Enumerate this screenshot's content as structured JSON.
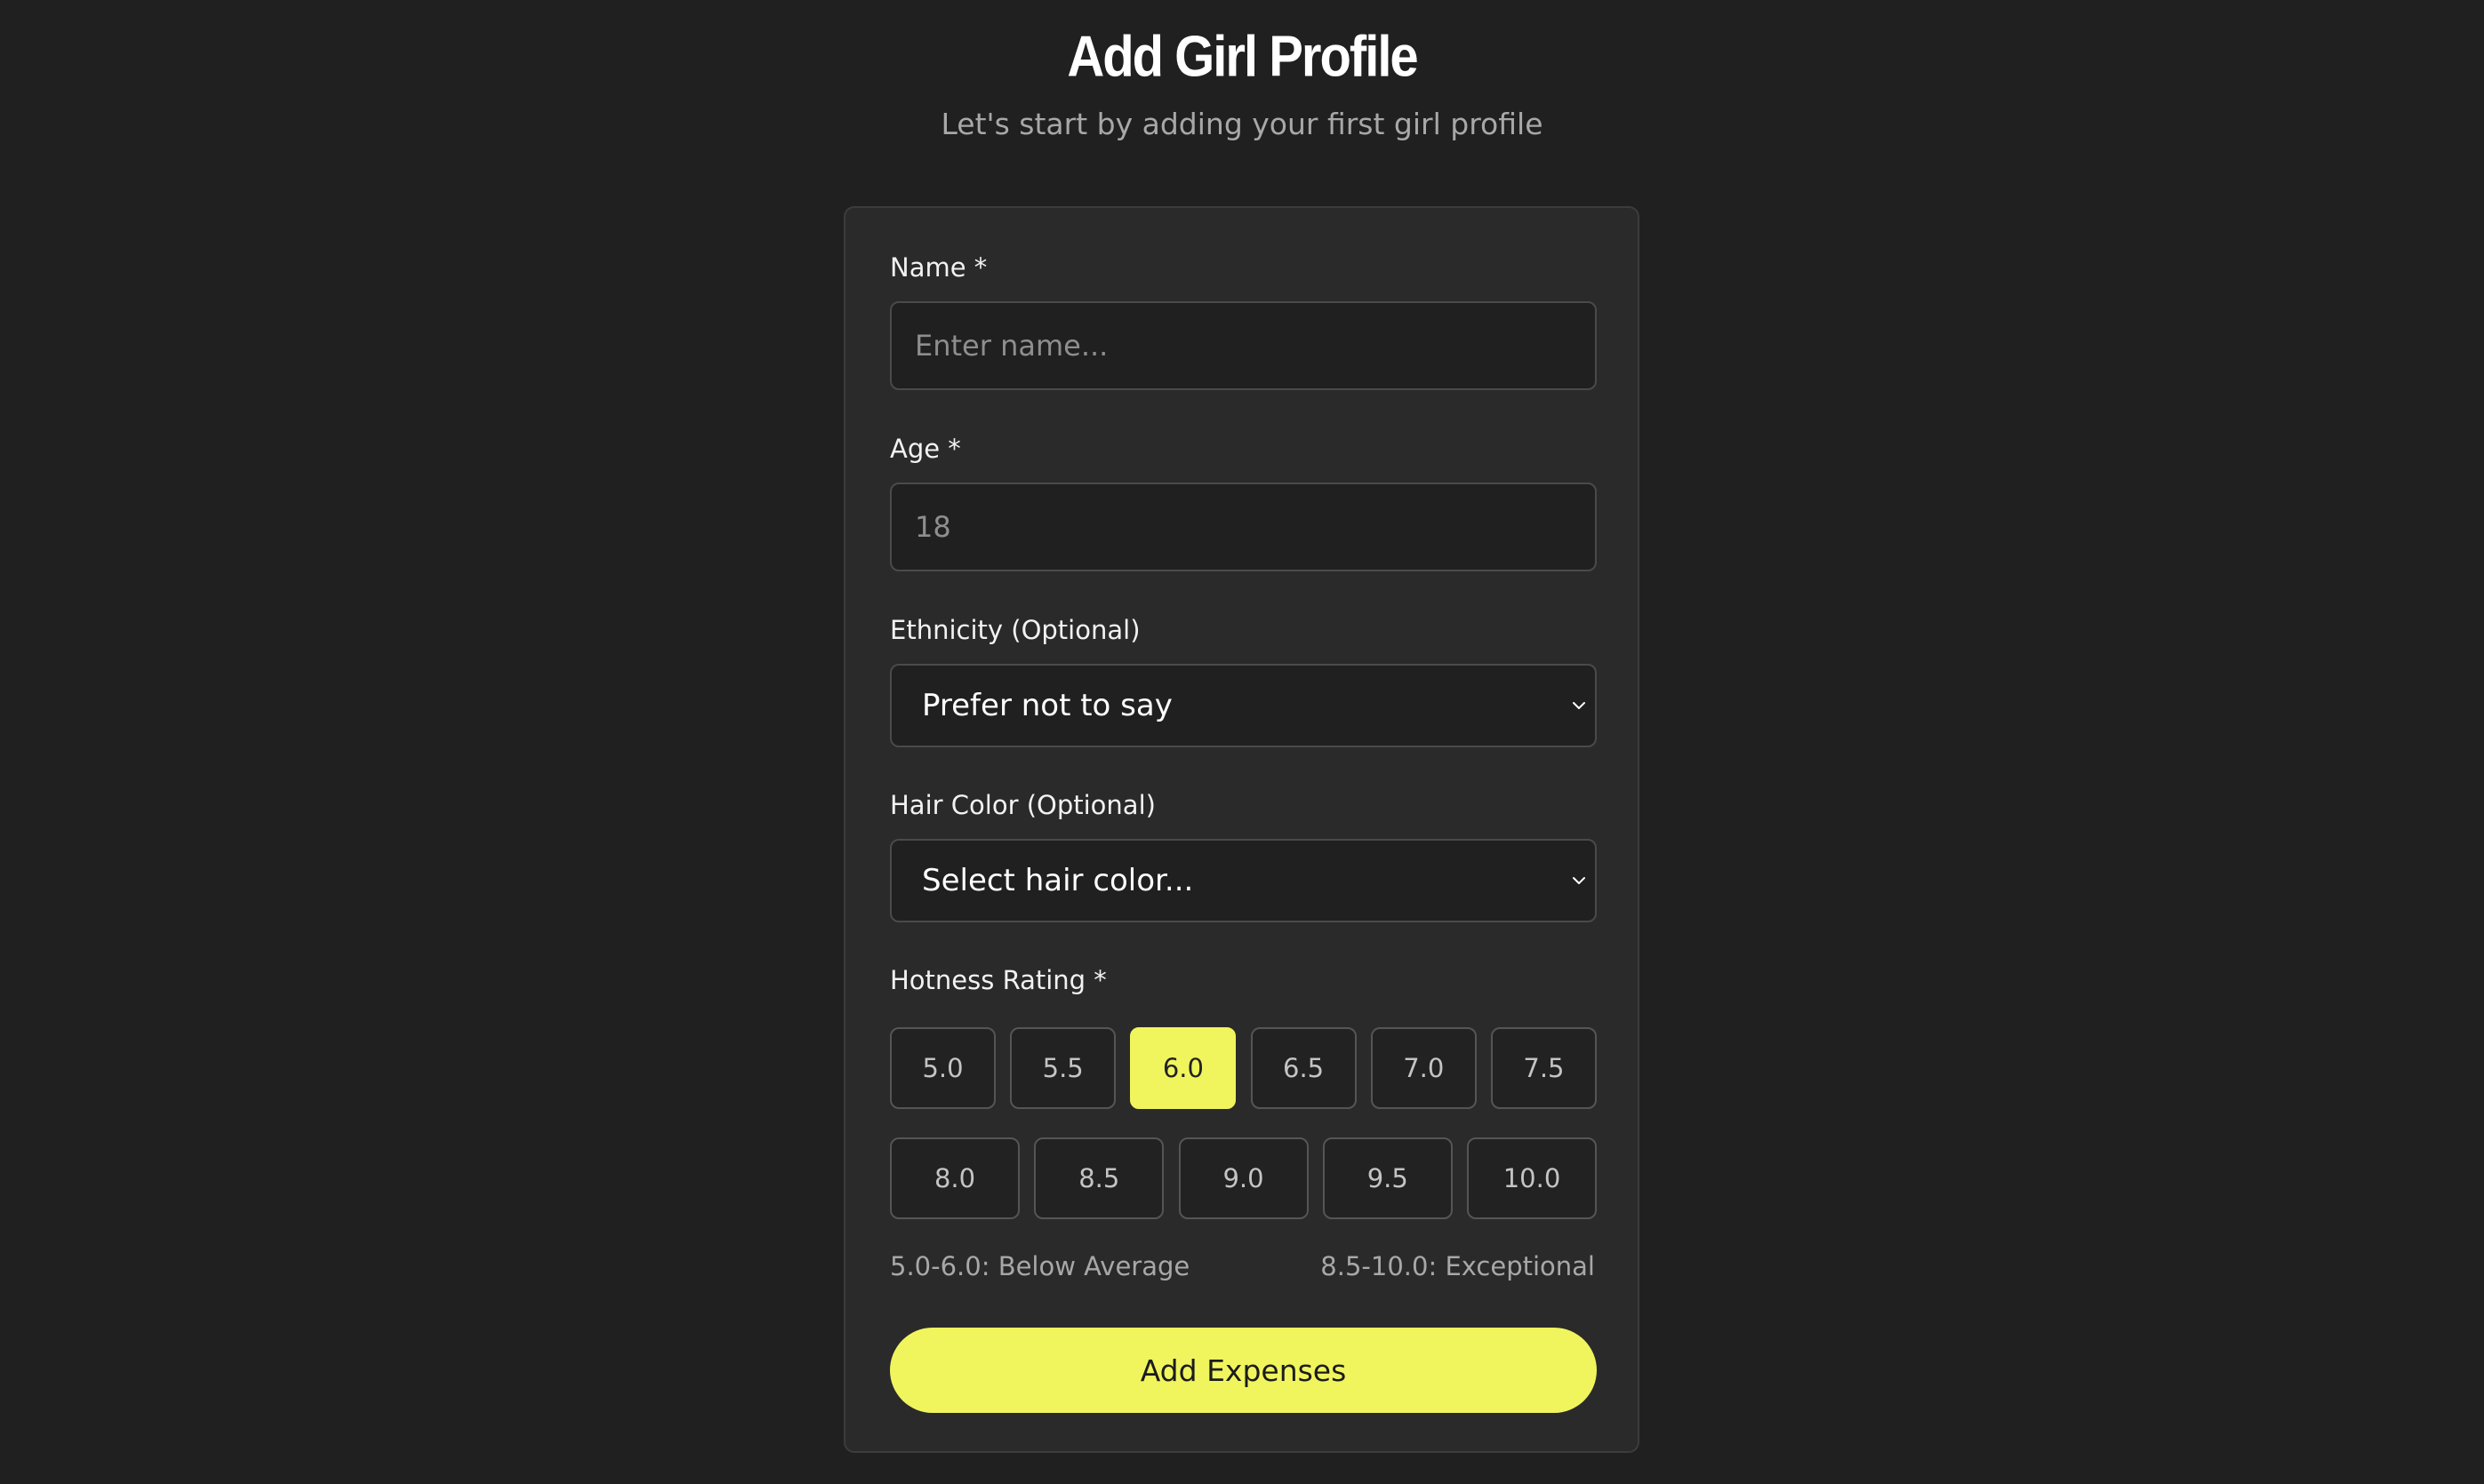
{
  "header": {
    "title": "Add Girl Profile",
    "subtitle": "Let's start by adding your first girl profile"
  },
  "form": {
    "name": {
      "label": "Name *",
      "placeholder": "Enter name..."
    },
    "age": {
      "label": "Age *",
      "placeholder": "18"
    },
    "ethnicity": {
      "label": "Ethnicity (Optional)",
      "value": "Prefer not to say"
    },
    "hair_color": {
      "label": "Hair Color (Optional)",
      "value": "Select hair color..."
    },
    "rating": {
      "label": "Hotness Rating *",
      "row1": [
        "5.0",
        "5.5",
        "6.0",
        "6.5",
        "7.0",
        "7.5"
      ],
      "row2": [
        "8.0",
        "8.5",
        "9.0",
        "9.5",
        "10.0"
      ],
      "selected": "6.0",
      "legend_low": "5.0-6.0: Below Average",
      "legend_high": "8.5-10.0: Exceptional"
    },
    "submit_label": "Add Expenses"
  },
  "colors": {
    "background": "#202020",
    "card": "#2a2a2a",
    "accent": "#f0f55e"
  },
  "icons": {
    "select_arrow": "chevron-down-icon"
  }
}
